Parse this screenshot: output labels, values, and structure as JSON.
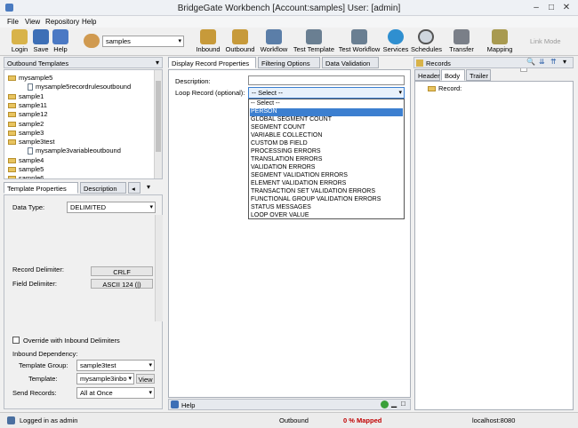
{
  "window": {
    "title": "BridgeGate Workbench [Account:samples] User: [admin]"
  },
  "menu": [
    "File",
    "View",
    "Repository",
    "Help"
  ],
  "toolbar": {
    "login": "Login",
    "save": "Save",
    "help": "Help",
    "account_value": "samples",
    "inbound": "Inbound",
    "outbound": "Outbound",
    "workflow": "Workflow",
    "test_template": "Test Template",
    "test_workflow": "Test Workflow",
    "services": "Services",
    "schedules": "Schedules",
    "transfer": "Transfer",
    "mapping": "Mapping",
    "link_mode": "Link Mode"
  },
  "left": {
    "header": "Outbound Templates",
    "tree": [
      {
        "label": "mysample5",
        "kind": "folder",
        "level": 0
      },
      {
        "label": "mysample5recordrulesoutbound",
        "kind": "doc",
        "level": 1
      },
      {
        "label": "sample1",
        "kind": "folder",
        "level": 0
      },
      {
        "label": "sample11",
        "kind": "folder",
        "level": 0
      },
      {
        "label": "sample12",
        "kind": "folder",
        "level": 0
      },
      {
        "label": "sample2",
        "kind": "folder",
        "level": 0
      },
      {
        "label": "sample3",
        "kind": "folder",
        "level": 0
      },
      {
        "label": "sample3test",
        "kind": "folder",
        "level": 0
      },
      {
        "label": "mysample3variableoutbound",
        "kind": "doc",
        "level": 1
      },
      {
        "label": "sample4",
        "kind": "folder",
        "level": 0
      },
      {
        "label": "sample5",
        "kind": "folder",
        "level": 0
      },
      {
        "label": "sample6",
        "kind": "folder",
        "level": 0
      }
    ],
    "tabs": [
      "Template Properties",
      "Description"
    ],
    "data_type_label": "Data Type:",
    "data_type_value": "DELIMITED",
    "record_delim_label": "Record Delimiter:",
    "record_delim_value": "CRLF",
    "field_delim_label": "Field Delimiter:",
    "field_delim_value": "ASCII 124 (|)",
    "override_label": "Override with Inbound Delimiters",
    "inbound_dep_label": "Inbound Dependency:",
    "template_group_label": "Template Group:",
    "template_group_value": "sample3test",
    "template_label": "Template:",
    "template_value": "mysample3inbo",
    "view_btn": "View",
    "send_records_label": "Send Records:",
    "send_records_value": "All at Once"
  },
  "center": {
    "tabs": [
      "Display Record Properties",
      "Filtering Options",
      "Data Validation"
    ],
    "description_label": "Description:",
    "loop_label": "Loop Record (optional):",
    "loop_value": "-- Select --",
    "options": [
      "-- Select --",
      "PERSON",
      "GLOBAL SEGMENT COUNT",
      "SEGMENT COUNT",
      "VARIABLE COLLECTION",
      "CUSTOM DB FIELD",
      "PROCESSING ERRORS",
      "TRANSLATION ERRORS",
      "VALIDATION ERRORS",
      "SEGMENT VALIDATION ERRORS",
      "ELEMENT VALIDATION ERRORS",
      "TRANSACTION SET VALIDATION ERRORS",
      "FUNCTIONAL GROUP VALIDATION ERRORS",
      "STATUS MESSAGES",
      "LOOP OVER VALUE"
    ],
    "help": "Help"
  },
  "right": {
    "header": "Records",
    "tabs": [
      "Header",
      "Body",
      "Trailer"
    ],
    "tree_root": "Record:"
  },
  "status": {
    "logged": "Logged in as admin",
    "mode": "Outbound",
    "mapped": "0 % Mapped",
    "host": "localhost:8080"
  }
}
